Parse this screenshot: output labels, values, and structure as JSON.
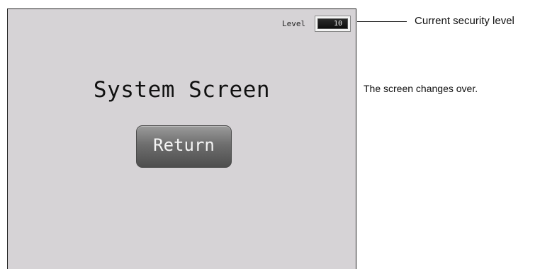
{
  "screen": {
    "level_label": "Level",
    "level_value": "10",
    "title": "System Screen",
    "return_label": "Return",
    "background_color": "#d6d3d6"
  },
  "annotations": {
    "level_callout": "Current security level",
    "screen_change": "The screen changes over."
  }
}
